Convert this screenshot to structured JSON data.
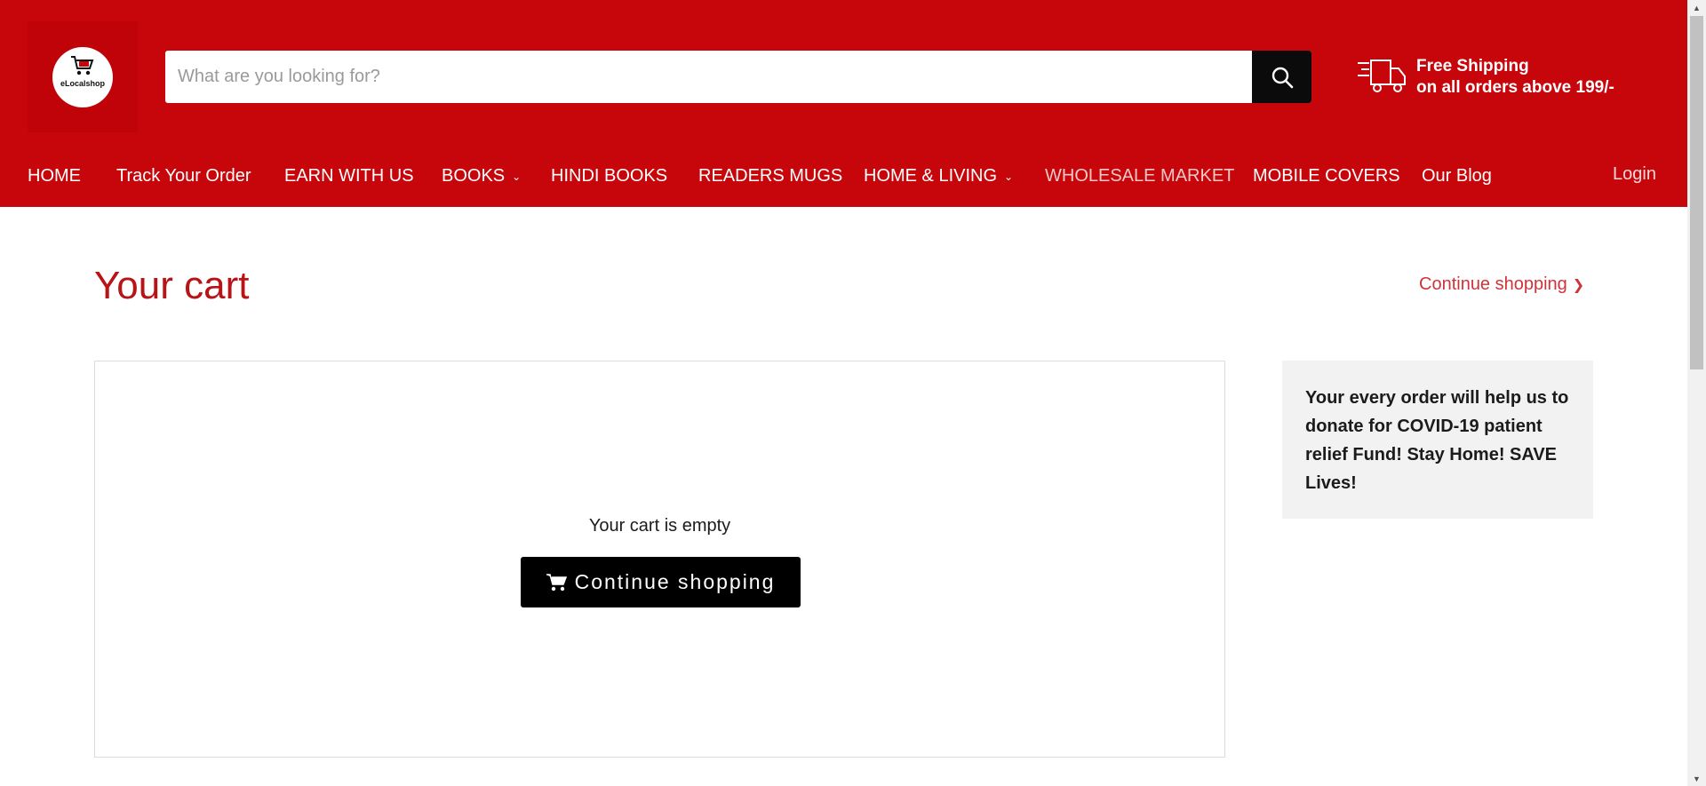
{
  "brand": {
    "name": "eLocalshop"
  },
  "search": {
    "placeholder": "What are you looking for?",
    "value": ""
  },
  "shipping": {
    "line1": "Free Shipping",
    "line2": "on all orders above 199/-"
  },
  "nav": {
    "items": [
      {
        "label": "HOME"
      },
      {
        "label": "Track Your Order"
      },
      {
        "label": "EARN WITH US"
      },
      {
        "label": "BOOKS"
      },
      {
        "label": "HINDI BOOKS"
      },
      {
        "label": "READERS MUGS"
      },
      {
        "label": "HOME & LIVING"
      },
      {
        "label": "WHOLESALE MARKET"
      },
      {
        "label": "MOBILE COVERS"
      },
      {
        "label": "Our Blog"
      }
    ],
    "login": "Login"
  },
  "main": {
    "title": "Your cart",
    "continue_link": "Continue shopping",
    "empty_text": "Your cart is empty",
    "continue_button": "Continue shopping"
  },
  "sidebar": {
    "notice": "Your every order will help us to donate for COVID-19 patient relief Fund! Stay Home! SAVE Lives!"
  },
  "colors": {
    "brand_red": "#c7060b",
    "title_red": "#b81417",
    "link_red": "#cf3339",
    "button_black": "#000000"
  },
  "icons": [
    "cart-logo-icon",
    "search-icon",
    "truck-icon",
    "chevron-down-icon",
    "chevron-right-icon",
    "cart-icon"
  ]
}
